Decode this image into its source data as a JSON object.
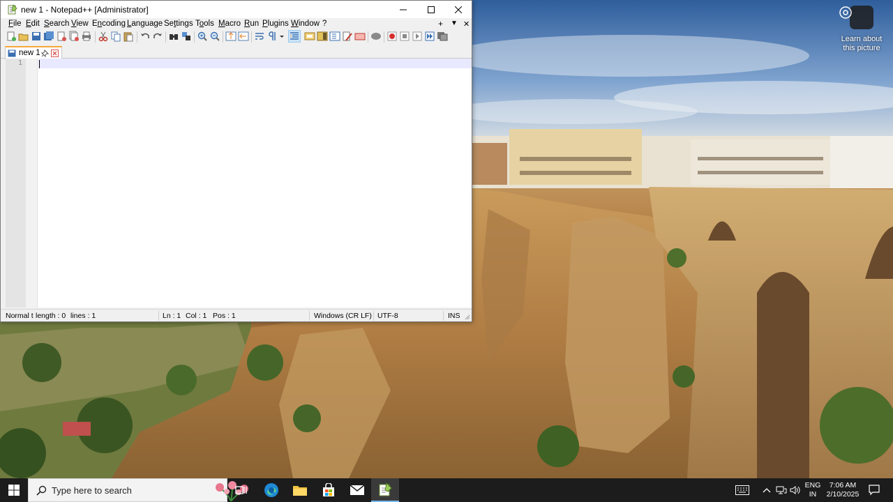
{
  "window": {
    "title": "new 1 - Notepad++ [Administrator]"
  },
  "menu": {
    "items": [
      {
        "label": "File",
        "accel": "F"
      },
      {
        "label": "Edit",
        "accel": "E"
      },
      {
        "label": "Search",
        "accel": "S"
      },
      {
        "label": "View",
        "accel": "V"
      },
      {
        "label": "Encoding",
        "accel": "n"
      },
      {
        "label": "Language",
        "accel": "L"
      },
      {
        "label": "Settings",
        "accel": "t"
      },
      {
        "label": "Tools",
        "accel": "o"
      },
      {
        "label": "Macro",
        "accel": "M"
      },
      {
        "label": "Run",
        "accel": "R"
      },
      {
        "label": "Plugins",
        "accel": "P"
      },
      {
        "label": "Window",
        "accel": "W"
      },
      {
        "label": "?",
        "accel": ""
      }
    ],
    "right_items": [
      "+",
      "▼",
      "✕"
    ]
  },
  "tabs": [
    {
      "label": "new 1"
    }
  ],
  "editor": {
    "line_numbers": [
      "1"
    ],
    "content": ""
  },
  "status": {
    "mode": "Normal t",
    "length": "length : 0",
    "lines": "lines : 1",
    "ln": "Ln : 1",
    "col": "Col : 1",
    "pos": "Pos : 1",
    "eol": "Windows (CR LF)",
    "encoding": "UTF-8",
    "ins": "INS"
  },
  "desktop": {
    "spotlight_label": "Learn about this picture"
  },
  "taskbar": {
    "search_placeholder": "Type here to search",
    "lang_line1": "ENG",
    "lang_line2": "IN",
    "time": "7:06 AM",
    "date": "2/10/2025"
  },
  "colors": {
    "taskbar_bg": "#1c1c1c",
    "active_tab_accent": "#f7a83a",
    "current_line": "#e8e8ff"
  }
}
